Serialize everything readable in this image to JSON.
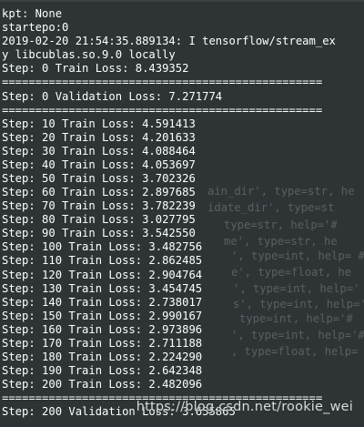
{
  "terminal": {
    "partial_top_line": "[partially visible line cut off at top]",
    "lines": [
      "kpt: None",
      "startepo:0",
      "2019-02-20 21:54:35.889134: I tensorflow/stream_ex",
      "y libcublas.so.9.0 locally",
      "Step: 0 Train Loss: 8.439352",
      "================================================",
      "Step: 0 Validation Loss: 7.271774",
      "================================================",
      "Step: 10 Train Loss: 4.591413",
      "Step: 20 Train Loss: 4.201633",
      "Step: 30 Train Loss: 4.088464",
      "Step: 40 Train Loss: 4.053697",
      "Step: 50 Train Loss: 3.702326",
      "Step: 60 Train Loss: 2.897685",
      "Step: 70 Train Loss: 3.782239",
      "Step: 80 Train Loss: 3.027795",
      "Step: 90 Train Loss: 3.542550",
      "Step: 100 Train Loss: 3.482756",
      "Step: 110 Train Loss: 2.862485",
      "Step: 120 Train Loss: 2.904764",
      "Step: 130 Train Loss: 3.454745",
      "Step: 140 Train Loss: 2.738017",
      "Step: 150 Train Loss: 2.990167",
      "Step: 160 Train Loss: 2.973896",
      "Step: 170 Train Loss: 2.711188",
      "Step: 180 Train Loss: 2.224290",
      "Step: 190 Train Loss: 2.642348",
      "Step: 200 Train Loss: 2.482096",
      "================================================",
      "Step: 200 Validation Loss: 3.655865"
    ]
  },
  "ghost_text": [
    "ain_dir', type=str, he",
    "idate_dir', type=st",
    "type=str, help='#",
    "me', type=str, he",
    "', type=int, help= #",
    "e', type=float, he",
    "', type=int, help='",
    "s', type=int, help='",
    "type=int, help='#",
    "', type=int, help='#",
    ", type=float, help="
  ],
  "watermark": "https://blog.csdn.net/rookie_wei",
  "colors": {
    "background": "#2e3436",
    "text": "#ffffff",
    "ghost": "#5a6062"
  }
}
